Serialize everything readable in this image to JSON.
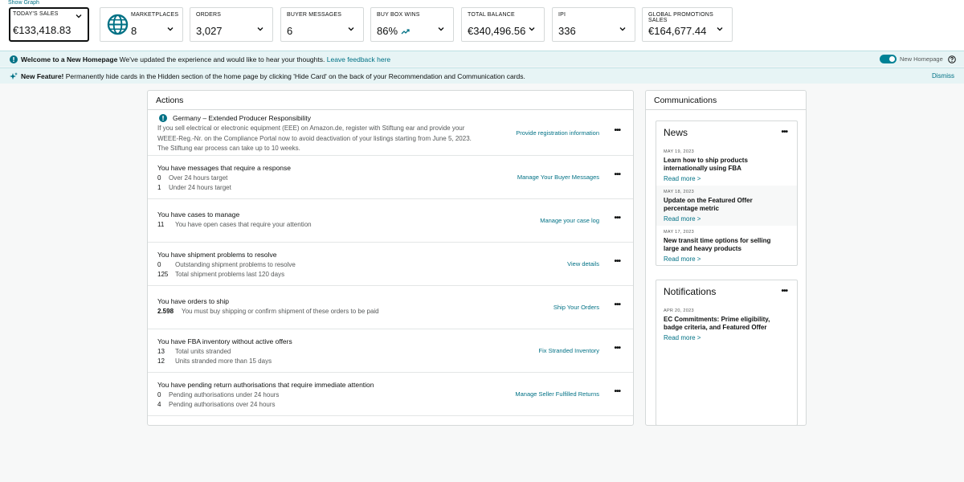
{
  "top": {
    "show_graph": "Show Graph",
    "metrics": [
      {
        "label": "TODAY'S SALES",
        "value": "€133,418.83"
      },
      {
        "label": "MARKETPLACES",
        "value": "8"
      },
      {
        "label": "ORDERS",
        "value": "3,027"
      },
      {
        "label": "BUYER MESSAGES",
        "value": "6"
      },
      {
        "label": "BUY BOX WINS",
        "value": "86%"
      },
      {
        "label": "TOTAL BALANCE",
        "value": "€340,496.56"
      },
      {
        "label": "IPI",
        "value": "336"
      },
      {
        "label": "GLOBAL PROMOTIONS SALES",
        "value": "€164,677.44"
      }
    ]
  },
  "banners": {
    "welcome_title": "Welcome to a New Homepage",
    "welcome_text": "We've updated the experience and would like to hear your thoughts.",
    "welcome_link": "Leave feedback here",
    "toggle_label": "New Homepage",
    "feature_title": "New Feature!",
    "feature_text": "Permanently hide cards in the Hidden section of the home page by clicking 'Hide Card' on the back of your Recommendation and Communication cards.",
    "dismiss": "Dismiss"
  },
  "actions": {
    "title": "Actions",
    "alert": {
      "title": "Germany – Extended Producer Responsibility",
      "desc": "If you sell electrical or electronic equipment (EEE) on Amazon.de, register with Stiftung ear and provide your WEEE-Reg.-Nr. on the Compliance Portal now to avoid deactivation of your listings starting from June 5, 2023. The Stiftung ear process can take up to 10 weeks.",
      "link": "Provide registration information"
    },
    "rows": [
      {
        "title": "You have messages that require a response",
        "lines": [
          {
            "num": "0",
            "text": "Over 24 hours target"
          },
          {
            "num": "1",
            "text": "Under 24 hours target"
          }
        ],
        "link": "Manage Your Buyer Messages"
      },
      {
        "title": "You have cases to manage",
        "lines": [
          {
            "num": "11",
            "text": "You have open cases that require your attention"
          }
        ],
        "link": "Manage your case log"
      },
      {
        "title": "You have shipment problems to resolve",
        "lines": [
          {
            "num": "0",
            "text": "Outstanding shipment problems to resolve"
          },
          {
            "num": "125",
            "text": "Total shipment problems last 120 days"
          }
        ],
        "link": "View details"
      },
      {
        "title": "You have orders to ship",
        "lines": [
          {
            "num": "2.598",
            "text": "You must buy shipping or confirm shipment of these orders to be paid"
          }
        ],
        "link": "Ship Your Orders"
      },
      {
        "title": "You have FBA inventory without active offers",
        "lines": [
          {
            "num": "13",
            "text": "Total units stranded"
          },
          {
            "num": "12",
            "text": "Units stranded more than 15 days"
          }
        ],
        "link": "Fix Stranded Inventory"
      },
      {
        "title": "You have pending return authorisations that require immediate attention",
        "lines": [
          {
            "num": "0",
            "text": "Pending authorisations under 24 hours"
          },
          {
            "num": "4",
            "text": "Pending authorisations over 24 hours"
          }
        ],
        "link": "Manage Seller Fulfilled Returns"
      }
    ]
  },
  "communications": {
    "title": "Communications",
    "news": {
      "title": "News",
      "items": [
        {
          "date": "MAY 19, 2023",
          "title": "Learn how to ship products internationally using FBA",
          "more": "Read more >"
        },
        {
          "date": "MAY 18, 2023",
          "title": "Update on the Featured Offer percentage metric",
          "more": "Read more >"
        },
        {
          "date": "MAY 17, 2023",
          "title": "New transit time options for selling large and heavy products",
          "more": "Read more >"
        }
      ]
    },
    "notifications": {
      "title": "Notifications",
      "items": [
        {
          "date": "APR 20, 2023",
          "title": "EC Commitments: Prime eligibility, badge criteria, and Featured Offer",
          "more": "Read more >"
        }
      ]
    }
  },
  "colors": {
    "teal": "#007185",
    "toggle": "#008296",
    "border": "#d5d9d9",
    "banner_bg": "#e7f4f5"
  }
}
